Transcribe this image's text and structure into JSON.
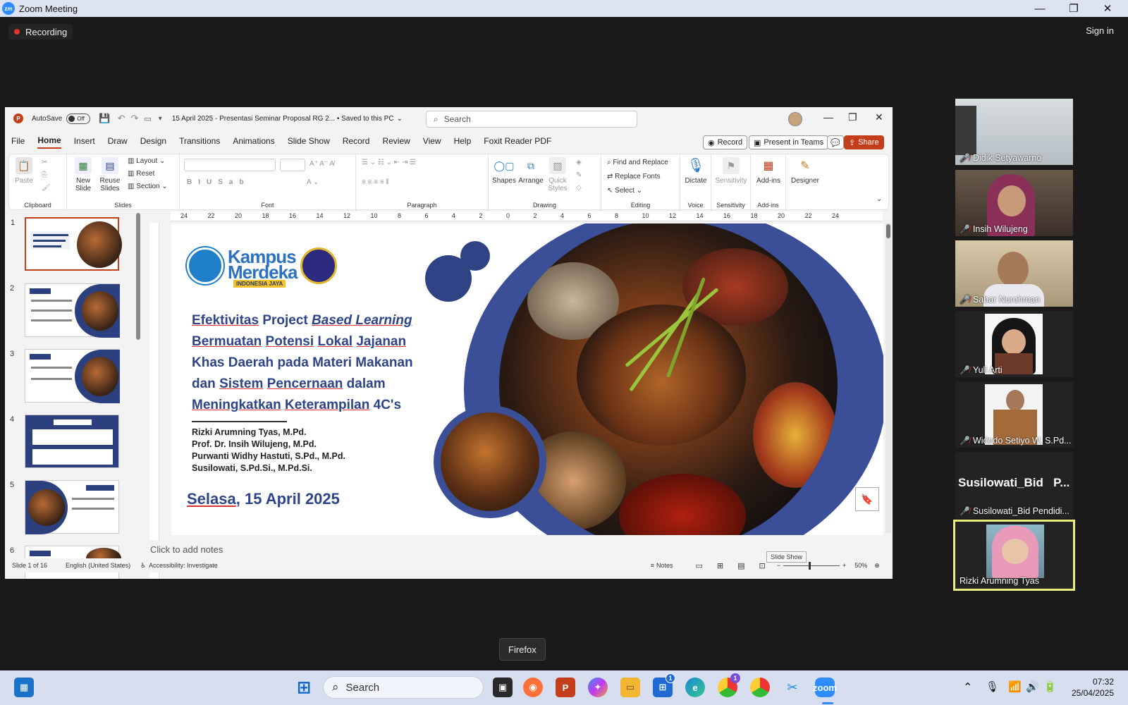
{
  "zoom": {
    "app_title": "Zoom Meeting",
    "logo_text": "zm",
    "minimize": "—",
    "restore": "❐",
    "close": "✕",
    "recording_label": "Recording",
    "sign_in": "Sign in"
  },
  "powerpoint": {
    "app_logo_text": "P",
    "autosave_label": "AutoSave",
    "autosave_state": "Off",
    "doc_title": "15 April 2025 - Presentasi Seminar Proposal RG 2... • Saved to this PC",
    "search_placeholder": "Search",
    "tabs": [
      "File",
      "Home",
      "Insert",
      "Draw",
      "Design",
      "Transitions",
      "Animations",
      "Slide Show",
      "Record",
      "Review",
      "View",
      "Help",
      "Foxit Reader PDF"
    ],
    "active_tab": "Home",
    "record_button": "Record",
    "present_teams_button": "Present in Teams",
    "share_button": "Share",
    "ribbon": {
      "clipboard": {
        "label": "Clipboard",
        "paste": "Paste"
      },
      "slides": {
        "label": "Slides",
        "new_slide": "New\nSlide",
        "reuse_slides": "Reuse\nSlides",
        "layout": "Layout",
        "reset": "Reset",
        "section": "Section"
      },
      "font": {
        "label": "Font"
      },
      "paragraph": {
        "label": "Paragraph"
      },
      "drawing": {
        "label": "Drawing",
        "shapes": "Shapes",
        "arrange": "Arrange",
        "quick_styles": "Quick\nStyles"
      },
      "editing": {
        "label": "Editing",
        "find_replace": "Find and Replace",
        "replace_fonts": "Replace Fonts",
        "select": "Select"
      },
      "voice": {
        "label": "Voice",
        "dictate": "Dictate"
      },
      "sensitivity": {
        "label": "Sensitivity",
        "button": "Sensitivity"
      },
      "addins": {
        "label": "Add-ins",
        "button": "Add-ins"
      },
      "designer": {
        "button": "Designer"
      }
    },
    "thumbnails": [
      "1",
      "2",
      "3",
      "4",
      "5",
      "6"
    ],
    "ruler_marks": [
      "24",
      "22",
      "20",
      "18",
      "16",
      "14",
      "12",
      "10",
      "8",
      "6",
      "4",
      "2",
      "0",
      "2",
      "4",
      "6",
      "8",
      "10",
      "12",
      "14",
      "16",
      "18",
      "20",
      "22",
      "24"
    ],
    "slide": {
      "logo_line1": "Kampus",
      "logo_line2": "Merdeka",
      "logo_tagline": "INDONESIA JAYA",
      "title_parts": [
        {
          "t": "Efektivitas",
          "u": true
        },
        {
          "t": " Project ",
          "u": false
        },
        {
          "t": "Based Learning",
          "u": true,
          "i": true
        },
        {
          "t": " ",
          "u": false
        },
        {
          "t": "Bermuatan",
          "u": true
        },
        {
          "t": " ",
          "u": false
        },
        {
          "t": "Potensi",
          "u": true
        },
        {
          "t": " ",
          "u": false
        },
        {
          "t": "Lokal",
          "u": true
        },
        {
          "t": " ",
          "u": false
        },
        {
          "t": "Jajanan",
          "u": true
        },
        {
          "t": " Khas Daerah pada Materi Makanan dan ",
          "u": false
        },
        {
          "t": "Sistem",
          "u": true
        },
        {
          "t": " ",
          "u": false
        },
        {
          "t": "Pencernaan",
          "u": true
        },
        {
          "t": " dalam ",
          "u": false
        },
        {
          "t": "Meningkatkan",
          "u": true
        },
        {
          "t": " ",
          "u": false
        },
        {
          "t": "Keterampilan",
          "u": true
        },
        {
          "t": " 4C's",
          "u": false
        }
      ],
      "authors": [
        "Rizki Arumning Tyas, M.Pd.",
        "Prof. Dr. Insih Wilujeng, M.Pd.",
        "Purwanti Widhy Hastuti, S.Pd., M.Pd.",
        "Susilowati, S.Pd.Si., M.Pd.Si."
      ],
      "date_day": "Selasa",
      "date_rest": ", 15 April 2025"
    },
    "notes_placeholder": "Click to add notes",
    "status": {
      "slide_count": "Slide 1 of 16",
      "language": "English (United States)",
      "accessibility": "Accessibility: Investigate",
      "notes": "Notes",
      "zoom": "50%",
      "slideshow_tooltip": "Slide Show"
    }
  },
  "participants": [
    {
      "name": "Didik Setyawarno"
    },
    {
      "name": "Insih Wilujeng"
    },
    {
      "name": "Sabar Nurohman"
    },
    {
      "name": "Yuli Arti"
    },
    {
      "name": "Widodo Setiyo W, S.Pd..."
    },
    {
      "name": "Susilowati_Bid Pendidi...",
      "display_text": "Susilowati_Bid   P..."
    },
    {
      "name": "Rizki Arumning Tyas",
      "active": true
    }
  ],
  "tooltip_firefox": "Firefox",
  "taskbar": {
    "search_label": "Search",
    "store_badge": "1",
    "chrome_badge": "1",
    "time": "07:32",
    "date": "25/04/2025"
  },
  "colors": {
    "ppt_accent": "#c43e1c",
    "slide_blue": "#2e4489",
    "active_speaker": "#e8f07a",
    "zoom_blue": "#2d8cff"
  }
}
